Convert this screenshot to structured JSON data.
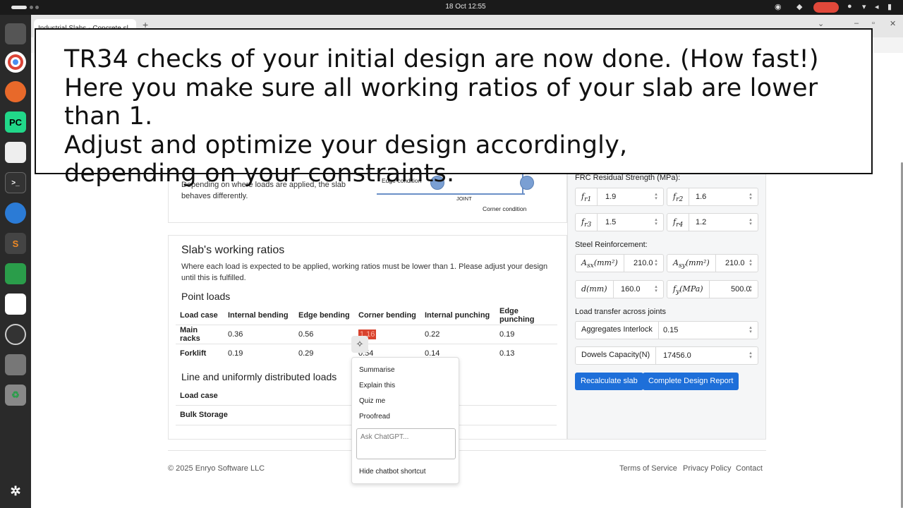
{
  "system": {
    "clock": "18 Oct  12:55"
  },
  "browser": {
    "tab_title": "Industrial Slabs - Concrete sl",
    "new_tab": "+"
  },
  "caption": {
    "lines": [
      "TR34 checks of your initial design are now done. (How fast!)",
      "Here you make sure all working ratios of your slab are lower than 1.",
      "Adjust and optimize your design accordingly,",
      "depending on your constraints."
    ]
  },
  "top_card": {
    "description": "Depending on where loads are applied, the slab behaves differently.",
    "diagram": {
      "edge": "Edge condition",
      "joint": "JOINT",
      "corner": "Corner condition"
    }
  },
  "ratios": {
    "title": "Slab's working ratios",
    "description": "Where each load is expected to be applied, working ratios must be lower than 1. Please adjust your design until this is fulfilled.",
    "point_title": "Point loads",
    "headers": [
      "Load case",
      "Internal bending",
      "Edge bending",
      "Corner bending",
      "Internal punching",
      "Edge punching"
    ],
    "rows": [
      {
        "case": "Main racks",
        "internal_bending": "0.36",
        "edge_bending": "0.56",
        "corner_bending": "1.16",
        "internal_punching": "0.22",
        "edge_punching": "0.19"
      },
      {
        "case": "Forklift",
        "internal_bending": "0.19",
        "edge_bending": "0.29",
        "corner_bending": "0.54",
        "internal_punching": "0.14",
        "edge_punching": "0.13"
      }
    ],
    "line_title": "Line and uniformly distributed loads",
    "line_header": "Load case",
    "line_rows": [
      "Bulk Storage"
    ]
  },
  "panel": {
    "frc_label": "FRC Residual Strength (MPa):",
    "fr1": {
      "label": "f",
      "sub": "r1",
      "value": "1.9"
    },
    "fr2": {
      "label": "f",
      "sub": "r2",
      "value": "1.6"
    },
    "fr3": {
      "label": "f",
      "sub": "r3",
      "value": "1.5"
    },
    "fr4": {
      "label": "f",
      "sub": "r4",
      "value": "1.2"
    },
    "steel_label": "Steel Reinforcement:",
    "asx": {
      "label": "A",
      "sub": "sx",
      "unit": "(mm²)",
      "value": "210.0"
    },
    "asy": {
      "label": "A",
      "sub": "sy",
      "unit": "(mm²)",
      "value": "210.0"
    },
    "d": {
      "label": "d(mm)",
      "value": "160.0"
    },
    "fy": {
      "label": "f",
      "sub": "y",
      "unit": "(MPa)",
      "value": "500.0"
    },
    "transfer_label": "Load transfer across joints",
    "aggregates": {
      "label": "Aggregates Interlock",
      "value": "0.15"
    },
    "dowels": {
      "label": "Dowels Capacity(N)",
      "value": "17456.0"
    },
    "recalc": "Recalculate slab",
    "report": "Complete Design Report"
  },
  "context_menu": {
    "items": [
      "Summarise",
      "Explain this",
      "Quiz me",
      "Proofread"
    ],
    "placeholder": "Ask ChatGPT...",
    "hide": "Hide chatbot shortcut"
  },
  "footer": {
    "copyright": "© 2025 Enryo Software LLC",
    "terms": "Terms of Service",
    "privacy": "Privacy Policy",
    "contact": "Contact"
  },
  "colors": {
    "accent": "#1e6fd9",
    "highlight": "#d8432e"
  }
}
